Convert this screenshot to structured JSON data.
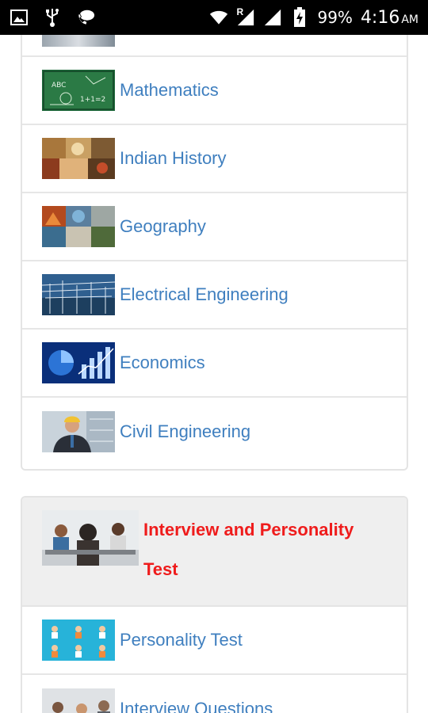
{
  "status_bar": {
    "battery": "99%",
    "time": "4:16",
    "ampm": "AM",
    "roaming_indicator": "R",
    "icons": [
      "gallery-icon",
      "usb-icon",
      "call-icon",
      "wifi-icon",
      "signal-icon",
      "signal-icon-2",
      "battery-charging-icon"
    ]
  },
  "subjects": {
    "items": [
      {
        "label": "Mathematics",
        "thumb": "chalkboard-thumbnail"
      },
      {
        "label": "Indian History",
        "thumb": "history-collage-thumbnail"
      },
      {
        "label": "Geography",
        "thumb": "geography-collage-thumbnail"
      },
      {
        "label": "Electrical Engineering",
        "thumb": "power-station-thumbnail"
      },
      {
        "label": "Economics",
        "thumb": "economics-chart-thumbnail"
      },
      {
        "label": "Civil Engineering",
        "thumb": "engineer-thumbnail"
      }
    ]
  },
  "interview_section": {
    "title": "Interview and Personality Test",
    "items": [
      {
        "label": "Personality Test",
        "thumb": "people-icons-thumbnail"
      },
      {
        "label": "Interview Questions",
        "thumb": "interview-panel-thumbnail"
      }
    ]
  },
  "colors": {
    "link": "#3f7fbf",
    "section_title": "#ef1c1c",
    "section_header_bg": "#efefef",
    "status_bar_bg": "#000000"
  }
}
